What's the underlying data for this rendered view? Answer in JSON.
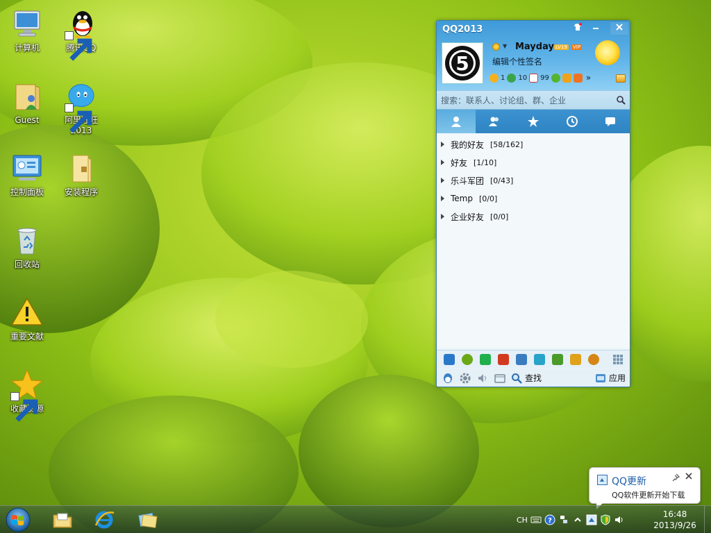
{
  "desktop": {
    "icons": [
      {
        "label": "计算机",
        "icon": "computer-icon"
      },
      {
        "label": "腾讯QQ",
        "icon": "qq-penguin-icon"
      },
      {
        "label": "Guest",
        "icon": "user-folder-icon"
      },
      {
        "label": "阿里旺旺\n2013",
        "icon": "aliwangwang-icon"
      },
      {
        "label": "控制面板",
        "icon": "control-panel-icon"
      },
      {
        "label": "安装程序",
        "icon": "folder-icon"
      },
      {
        "label": "回收站",
        "icon": "recycle-bin-icon"
      },
      {
        "label": "重要文献",
        "icon": "warning-icon"
      },
      {
        "label": "收藏资源",
        "icon": "star-icon"
      }
    ]
  },
  "qq": {
    "title": "QQ2013",
    "nickname": "Mayday",
    "level_badge": "LV19",
    "vip_badge": "VIP",
    "signature": "编辑个性签名",
    "stats": {
      "stars": "1",
      "sync": "10",
      "mail": "99"
    },
    "more": "»",
    "search_placeholder": "搜索：联系人、讨论组、群、企业",
    "tabs": [
      "contacts-icon",
      "groups-icon",
      "favorites-icon",
      "recent-icon",
      "chat-icon"
    ],
    "groups": [
      {
        "name": "我的好友",
        "count": "[58/162]"
      },
      {
        "name": "好友",
        "count": "[1/10]"
      },
      {
        "name": "乐斗军团",
        "count": "[0/43]"
      },
      {
        "name": "Temp",
        "count": "[0/0]"
      },
      {
        "name": "企业好友",
        "count": "[0/0]"
      }
    ],
    "apps_colors": [
      "#2a78c9",
      "#6aa817",
      "#1fb04b",
      "#d23a1f",
      "#3a7cc0",
      "#27a4c7",
      "#4c9a2a",
      "#e0a21b",
      "#d68617"
    ],
    "find_label": "查找",
    "apps_label": "应用"
  },
  "balloon": {
    "title": "QQ更新",
    "message": "QQ软件更新开始下载"
  },
  "taskbar": {
    "ime": "CH",
    "time": "16:48",
    "date": "2013/9/26"
  }
}
